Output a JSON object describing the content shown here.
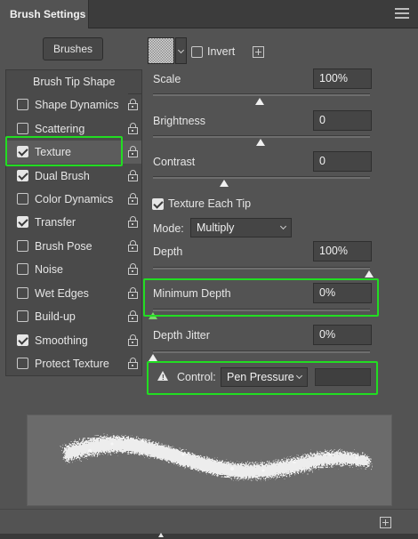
{
  "panel": {
    "title": "Brush Settings"
  },
  "brushes_button": "Brushes",
  "sections": [
    {
      "label": "Brush Tip Shape",
      "has_checkbox": false,
      "checked": false
    },
    {
      "label": "Shape Dynamics",
      "has_checkbox": true,
      "checked": false
    },
    {
      "label": "Scattering",
      "has_checkbox": true,
      "checked": false
    },
    {
      "label": "Texture",
      "has_checkbox": true,
      "checked": true
    },
    {
      "label": "Dual Brush",
      "has_checkbox": true,
      "checked": true
    },
    {
      "label": "Color Dynamics",
      "has_checkbox": true,
      "checked": false
    },
    {
      "label": "Transfer",
      "has_checkbox": true,
      "checked": true
    },
    {
      "label": "Brush Pose",
      "has_checkbox": true,
      "checked": false
    },
    {
      "label": "Noise",
      "has_checkbox": true,
      "checked": false
    },
    {
      "label": "Wet Edges",
      "has_checkbox": true,
      "checked": false
    },
    {
      "label": "Build-up",
      "has_checkbox": true,
      "checked": false
    },
    {
      "label": "Smoothing",
      "has_checkbox": true,
      "checked": true
    },
    {
      "label": "Protect Texture",
      "has_checkbox": true,
      "checked": false
    }
  ],
  "texture": {
    "invert_label": "Invert",
    "invert_checked": false,
    "scale": {
      "label": "Scale",
      "value": "100%",
      "slider": 0.5
    },
    "brightness": {
      "label": "Brightness",
      "value": "0",
      "slider": 0.5
    },
    "contrast": {
      "label": "Contrast",
      "value": "0",
      "slider": 0.33
    },
    "texture_each_tip": {
      "label": "Texture Each Tip",
      "checked": true
    },
    "mode": {
      "label": "Mode:",
      "value": "Multiply"
    },
    "depth": {
      "label": "Depth",
      "value": "100%",
      "slider": 1.0
    },
    "minimum_depth": {
      "label": "Minimum Depth",
      "value": "0%",
      "slider": 0.0
    },
    "depth_jitter": {
      "label": "Depth Jitter",
      "value": "0%",
      "slider": 0.0
    },
    "control": {
      "label": "Control:",
      "value": "Pen Pressure"
    }
  },
  "colors": {
    "highlight": "#22dd22",
    "panel_bg": "#535353"
  },
  "icons": [
    "lock-icon",
    "new-preset-icon",
    "warning-icon",
    "panel-menu-icon",
    "chevron-down-icon"
  ]
}
